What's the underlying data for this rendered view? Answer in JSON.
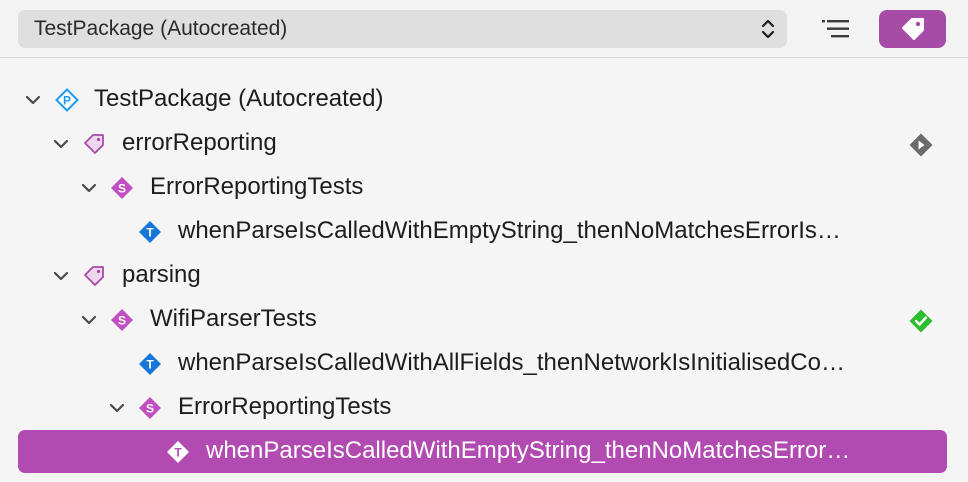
{
  "toolbar": {
    "scheme": "TestPackage (Autocreated)"
  },
  "tree": {
    "rows": [
      {
        "label": "TestPackage (Autocreated)"
      },
      {
        "label": "errorReporting"
      },
      {
        "label": "ErrorReportingTests"
      },
      {
        "label": "whenParseIsCalledWithEmptyString_thenNoMatchesErrorIs…"
      },
      {
        "label": "parsing"
      },
      {
        "label": "WifiParserTests"
      },
      {
        "label": "whenParseIsCalledWithAllFields_thenNetworkIsInitialisedCo…"
      },
      {
        "label": "ErrorReportingTests"
      },
      {
        "label": "whenParseIsCalledWithEmptyString_thenNoMatchesError…"
      }
    ]
  },
  "colors": {
    "accent": "#b14bb1",
    "package_icon": "#1e9bf0",
    "tag_icon": "#a64ca6",
    "suite_icon": "#c24fc2",
    "test_icon": "#1677d9",
    "pass": "#2ebd2e",
    "run": "#6b6b6b"
  },
  "icons": {
    "package": "package-icon",
    "tag": "tag-icon",
    "suite": "test-suite-icon",
    "test": "test-case-icon",
    "passed": "test-passed-icon",
    "run": "run-test-icon"
  }
}
